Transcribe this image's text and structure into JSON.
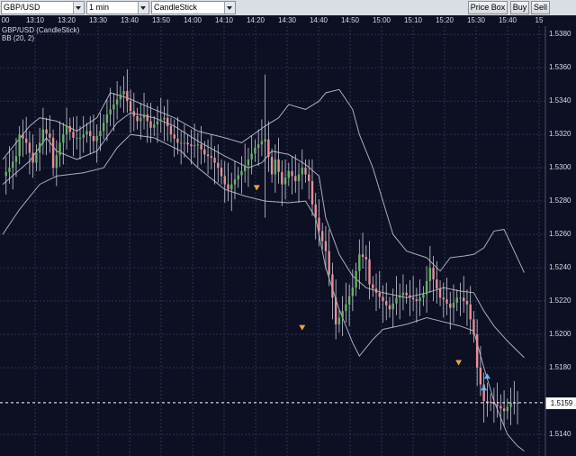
{
  "toolbar": {
    "symbol": "GBP/USD",
    "timeframe": "1 min",
    "chart_style": "CandleStick",
    "price_box_label": "Price Box",
    "buy_label": "Buy",
    "sell_label": "Sell"
  },
  "legend": {
    "title": "GBP/USD (CandleStick)",
    "indicator": "BB (20, 2)"
  },
  "current_price": "1.5159",
  "colors": {
    "background": "#0d0f23",
    "grid": "#2a3550",
    "up_candle": "#66b266",
    "down_candle": "#e58f97",
    "wick": "#c8ccd6",
    "bands": "#c6c9d2",
    "sell_arrow": "#e6a540",
    "buy_arrow": "#62b9ee"
  },
  "chart_data": {
    "type": "line",
    "x_tick_labels": [
      "00",
      "13:10",
      "13:20",
      "13:30",
      "13:40",
      "13:50",
      "14:00",
      "14:10",
      "14:20",
      "14:30",
      "14:40",
      "14:50",
      "15:00",
      "15:10",
      "15:20",
      "15:30",
      "15:40",
      "15"
    ],
    "y_tick_labels": [
      "1.5380",
      "1.5360",
      "1.5340",
      "1.5320",
      "1.5300",
      "1.5280",
      "1.5260",
      "1.5240",
      "1.5220",
      "1.5200",
      "1.5180",
      "1.5159",
      "1.5140"
    ],
    "ylim": [
      1.5127,
      1.5385
    ],
    "xlim": [
      0,
      157
    ],
    "series": [
      {
        "key": "upper",
        "points": [
          [
            0,
            1.5305
          ],
          [
            8,
            1.5325
          ],
          [
            11,
            1.533
          ],
          [
            16,
            1.5328
          ],
          [
            22,
            1.5322
          ],
          [
            28,
            1.533
          ],
          [
            32,
            1.5345
          ],
          [
            37,
            1.5342
          ],
          [
            45,
            1.5335
          ],
          [
            51,
            1.533
          ],
          [
            58,
            1.5322
          ],
          [
            66,
            1.5318
          ],
          [
            71,
            1.5315
          ],
          [
            78,
            1.5325
          ],
          [
            82,
            1.533
          ],
          [
            85,
            1.5338
          ],
          [
            90,
            1.5335
          ],
          [
            94,
            1.534
          ],
          [
            96,
            1.5345
          ],
          [
            100,
            1.5347
          ],
          [
            104,
            1.5335
          ],
          [
            106,
            1.532
          ],
          [
            110,
            1.53
          ],
          [
            113,
            1.528
          ],
          [
            116,
            1.526
          ],
          [
            120,
            1.525
          ],
          [
            126,
            1.5246
          ],
          [
            130,
            1.5238
          ],
          [
            133,
            1.5246
          ],
          [
            137,
            1.5247
          ],
          [
            140,
            1.5248
          ],
          [
            143,
            1.5252
          ],
          [
            146,
            1.5262
          ],
          [
            149,
            1.5263
          ],
          [
            152,
            1.525
          ],
          [
            155,
            1.5237
          ]
        ]
      },
      {
        "key": "middle",
        "points": [
          [
            0,
            1.529
          ],
          [
            8,
            1.5304
          ],
          [
            13,
            1.5318
          ],
          [
            16,
            1.531
          ],
          [
            22,
            1.5305
          ],
          [
            28,
            1.531
          ],
          [
            34,
            1.5327
          ],
          [
            38,
            1.5333
          ],
          [
            45,
            1.533
          ],
          [
            51,
            1.5325
          ],
          [
            58,
            1.5316
          ],
          [
            66,
            1.5307
          ],
          [
            73,
            1.53
          ],
          [
            77,
            1.5303
          ],
          [
            80,
            1.531
          ],
          [
            85,
            1.5308
          ],
          [
            90,
            1.5302
          ],
          [
            94,
            1.5295
          ],
          [
            96,
            1.527
          ],
          [
            100,
            1.5248
          ],
          [
            104,
            1.5235
          ],
          [
            108,
            1.5228
          ],
          [
            113,
            1.5225
          ],
          [
            120,
            1.5222
          ],
          [
            126,
            1.5225
          ],
          [
            131,
            1.5228
          ],
          [
            136,
            1.5226
          ],
          [
            140,
            1.5225
          ],
          [
            143,
            1.5214
          ],
          [
            146,
            1.5205
          ],
          [
            150,
            1.5196
          ],
          [
            153,
            1.519
          ],
          [
            155,
            1.5186
          ]
        ]
      },
      {
        "key": "lower",
        "points": [
          [
            0,
            1.526
          ],
          [
            5,
            1.5275
          ],
          [
            11,
            1.529
          ],
          [
            16,
            1.5295
          ],
          [
            24,
            1.5297
          ],
          [
            30,
            1.53
          ],
          [
            34,
            1.5312
          ],
          [
            38,
            1.532
          ],
          [
            45,
            1.5318
          ],
          [
            53,
            1.531
          ],
          [
            58,
            1.53
          ],
          [
            66,
            1.5287
          ],
          [
            72,
            1.5283
          ],
          [
            78,
            1.528
          ],
          [
            85,
            1.5279
          ],
          [
            90,
            1.528
          ],
          [
            93,
            1.527
          ],
          [
            96,
            1.524
          ],
          [
            100,
            1.5215
          ],
          [
            104,
            1.5195
          ],
          [
            106,
            1.5187
          ],
          [
            110,
            1.5197
          ],
          [
            113,
            1.5203
          ],
          [
            120,
            1.5206
          ],
          [
            126,
            1.521
          ],
          [
            130,
            1.5208
          ],
          [
            136,
            1.5205
          ],
          [
            140,
            1.5202
          ],
          [
            143,
            1.518
          ],
          [
            146,
            1.516
          ],
          [
            150,
            1.514
          ],
          [
            153,
            1.5133
          ],
          [
            155,
            1.513
          ]
        ]
      },
      {
        "key": "close",
        "points": [
          [
            0,
            1.5295
          ],
          [
            2,
            1.53
          ],
          [
            4,
            1.5307
          ],
          [
            5,
            1.532
          ],
          [
            7,
            1.5315
          ],
          [
            9,
            1.5303
          ],
          [
            11,
            1.5315
          ],
          [
            12,
            1.5323
          ],
          [
            14,
            1.5318
          ],
          [
            15,
            1.53
          ],
          [
            17,
            1.5315
          ],
          [
            19,
            1.5325
          ],
          [
            21,
            1.5318
          ],
          [
            23,
            1.5318
          ],
          [
            25,
            1.5322
          ],
          [
            27,
            1.5316
          ],
          [
            29,
            1.5322
          ],
          [
            31,
            1.5332
          ],
          [
            33,
            1.5338
          ],
          [
            35,
            1.5344
          ],
          [
            36,
            1.5346
          ],
          [
            38,
            1.5334
          ],
          [
            40,
            1.5328
          ],
          [
            42,
            1.5332
          ],
          [
            44,
            1.5324
          ],
          [
            46,
            1.5328
          ],
          [
            48,
            1.533
          ],
          [
            50,
            1.532
          ],
          [
            52,
            1.5315
          ],
          [
            54,
            1.5315
          ],
          [
            56,
            1.5313
          ],
          [
            58,
            1.5314
          ],
          [
            60,
            1.5308
          ],
          [
            62,
            1.5306
          ],
          [
            64,
            1.53
          ],
          [
            66,
            1.529
          ],
          [
            67,
            1.5287
          ],
          [
            69,
            1.5293
          ],
          [
            71,
            1.5298
          ],
          [
            73,
            1.5305
          ],
          [
            75,
            1.5312
          ],
          [
            77,
            1.5316
          ],
          [
            78,
            1.5317
          ],
          [
            80,
            1.5296
          ],
          [
            81,
            1.5305
          ],
          [
            83,
            1.529
          ],
          [
            85,
            1.5298
          ],
          [
            87,
            1.5292
          ],
          [
            89,
            1.53
          ],
          [
            91,
            1.5292
          ],
          [
            92,
            1.5278
          ],
          [
            94,
            1.5262
          ],
          [
            96,
            1.525
          ],
          [
            98,
            1.5222
          ],
          [
            99,
            1.5206
          ],
          [
            100,
            1.521
          ],
          [
            102,
            1.5218
          ],
          [
            104,
            1.5228
          ],
          [
            106,
            1.5248
          ],
          [
            108,
            1.5245
          ],
          [
            109,
            1.523
          ],
          [
            111,
            1.5225
          ],
          [
            113,
            1.522
          ],
          [
            115,
            1.5215
          ],
          [
            117,
            1.5222
          ],
          [
            119,
            1.5225
          ],
          [
            121,
            1.5222
          ],
          [
            123,
            1.522
          ],
          [
            125,
            1.5224
          ],
          [
            127,
            1.524
          ],
          [
            128,
            1.5233
          ],
          [
            130,
            1.5222
          ],
          [
            131,
            1.5221
          ],
          [
            133,
            1.5216
          ],
          [
            135,
            1.5222
          ],
          [
            136,
            1.5222
          ],
          [
            138,
            1.5218
          ],
          [
            140,
            1.52
          ],
          [
            141,
            1.518
          ],
          [
            143,
            1.516
          ],
          [
            145,
            1.5159
          ],
          [
            147,
            1.5157
          ],
          [
            149,
            1.5154
          ],
          [
            151,
            1.5159
          ],
          [
            153,
            1.5159
          ]
        ]
      }
    ],
    "sell_signals": [
      [
        75.5,
        1.5288
      ],
      [
        89,
        1.5204
      ],
      [
        135.5,
        1.5183
      ]
    ],
    "buy_signals": [
      [
        143,
        1.5168
      ],
      [
        144,
        1.5175
      ]
    ]
  }
}
